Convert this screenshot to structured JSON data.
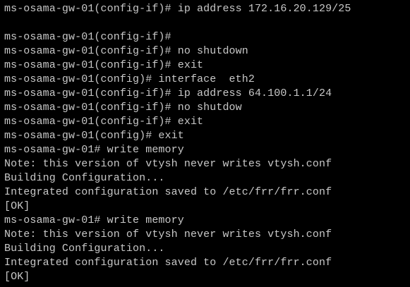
{
  "terminal": {
    "lines": [
      "ms-osama-gw-01(config-if)# ip address 172.16.20.129/25",
      "",
      "ms-osama-gw-01(config-if)#",
      "ms-osama-gw-01(config-if)# no shutdown",
      "ms-osama-gw-01(config-if)# exit",
      "ms-osama-gw-01(config)# interface  eth2",
      "ms-osama-gw-01(config-if)# ip address 64.100.1.1/24",
      "ms-osama-gw-01(config-if)# no shutdow",
      "ms-osama-gw-01(config-if)# exit",
      "ms-osama-gw-01(config)# exit",
      "ms-osama-gw-01# write memory",
      "Note: this version of vtysh never writes vtysh.conf",
      "Building Configuration...",
      "Integrated configuration saved to /etc/frr/frr.conf",
      "[OK]",
      "ms-osama-gw-01# write memory",
      "Note: this version of vtysh never writes vtysh.conf",
      "Building Configuration...",
      "Integrated configuration saved to /etc/frr/frr.conf",
      "[OK]"
    ]
  },
  "colors": {
    "background": "#000000",
    "foreground": "#c8c8c8"
  }
}
